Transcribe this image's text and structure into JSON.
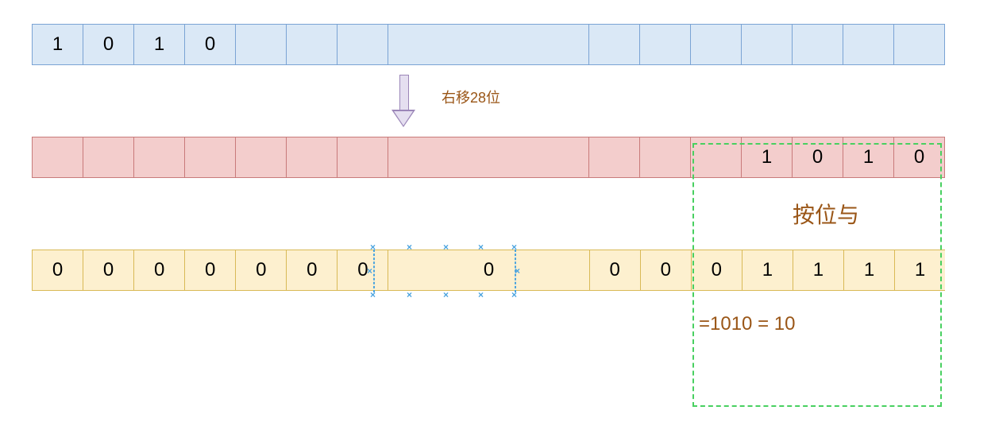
{
  "rows": {
    "blue": {
      "bits": [
        "1",
        "0",
        "1",
        "0",
        "",
        "",
        "",
        ""
      ],
      "end": [
        "",
        "",
        "",
        "",
        "",
        "",
        ""
      ]
    },
    "pink": {
      "bitsStart": [
        "",
        "",
        "",
        "",
        "",
        "",
        "",
        ""
      ],
      "bitsMid": [
        "",
        "",
        "",
        ""
      ],
      "bitsEnd": [
        "1",
        "0",
        "1",
        "0"
      ]
    },
    "yellow": {
      "bitsStart": [
        "0",
        "0",
        "0",
        "0",
        "0",
        "0",
        "0"
      ],
      "midWide": "0",
      "after": [
        "0",
        "0",
        "0",
        "1",
        "1",
        "1",
        "1"
      ]
    }
  },
  "labels": {
    "shift": "右移28位",
    "and": "按位与",
    "result": "=1010 = 10"
  }
}
